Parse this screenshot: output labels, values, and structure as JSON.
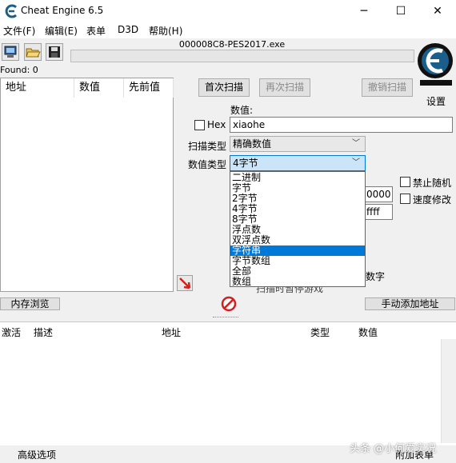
{
  "window": {
    "title": "Cheat Engine 6.5",
    "minimize": "─",
    "maximize": "☐",
    "close": "✕"
  },
  "menu": [
    "文件(F)",
    "编辑(E)",
    "表单",
    "D3D",
    "帮助(H)"
  ],
  "process_name": "000008C8-PES2017.exe",
  "found_label": "Found: 0",
  "settings_label": "设置",
  "found_list": {
    "headers": [
      "地址",
      "数值",
      "先前值"
    ]
  },
  "scan": {
    "first_scan": "首次扫描",
    "next_scan": "再次扫描",
    "undo_scan": "撤销扫描",
    "value_label": "数值:",
    "hex_label": "Hex",
    "value_input": "xiaohe",
    "scan_type_label": "扫描类型",
    "scan_type_value": "精确数值",
    "value_type_label": "数值类型",
    "value_type_value": "4字节"
  },
  "value_type_options": [
    "二进制",
    "字节",
    "2字节",
    "4字节",
    "8字节",
    "浮点数",
    "双浮点数",
    "字符串",
    "字节数组",
    "全部",
    "数组"
  ],
  "selected_option_index": 7,
  "partial_fields": {
    "start_fragment": "0000",
    "stop_fragment": "ffff",
    "digits_fragment": "数字",
    "pause_fragment": "扫描时暂停游戏"
  },
  "options": {
    "disable_random": "禁止随机",
    "speedhack": "速度修改"
  },
  "memory_view_button": "内存浏览",
  "add_address_button": "手动添加地址",
  "address_list": {
    "headers": [
      "激活",
      "描述",
      "地址",
      "类型",
      "数值"
    ]
  },
  "status": {
    "advanced": "高级选项",
    "table_extras": "附加表单"
  },
  "watermark": "头条 @小何爱实况",
  "icons": {
    "app": "cheat-engine-icon",
    "process": "computer-icon",
    "open": "folder-open-icon",
    "save": "floppy-disk-icon",
    "pointer": "red-arrow-icon",
    "stop": "stop-sign-icon"
  },
  "colors": {
    "selection": "#0078d7",
    "logo": "#1a5f8c"
  }
}
